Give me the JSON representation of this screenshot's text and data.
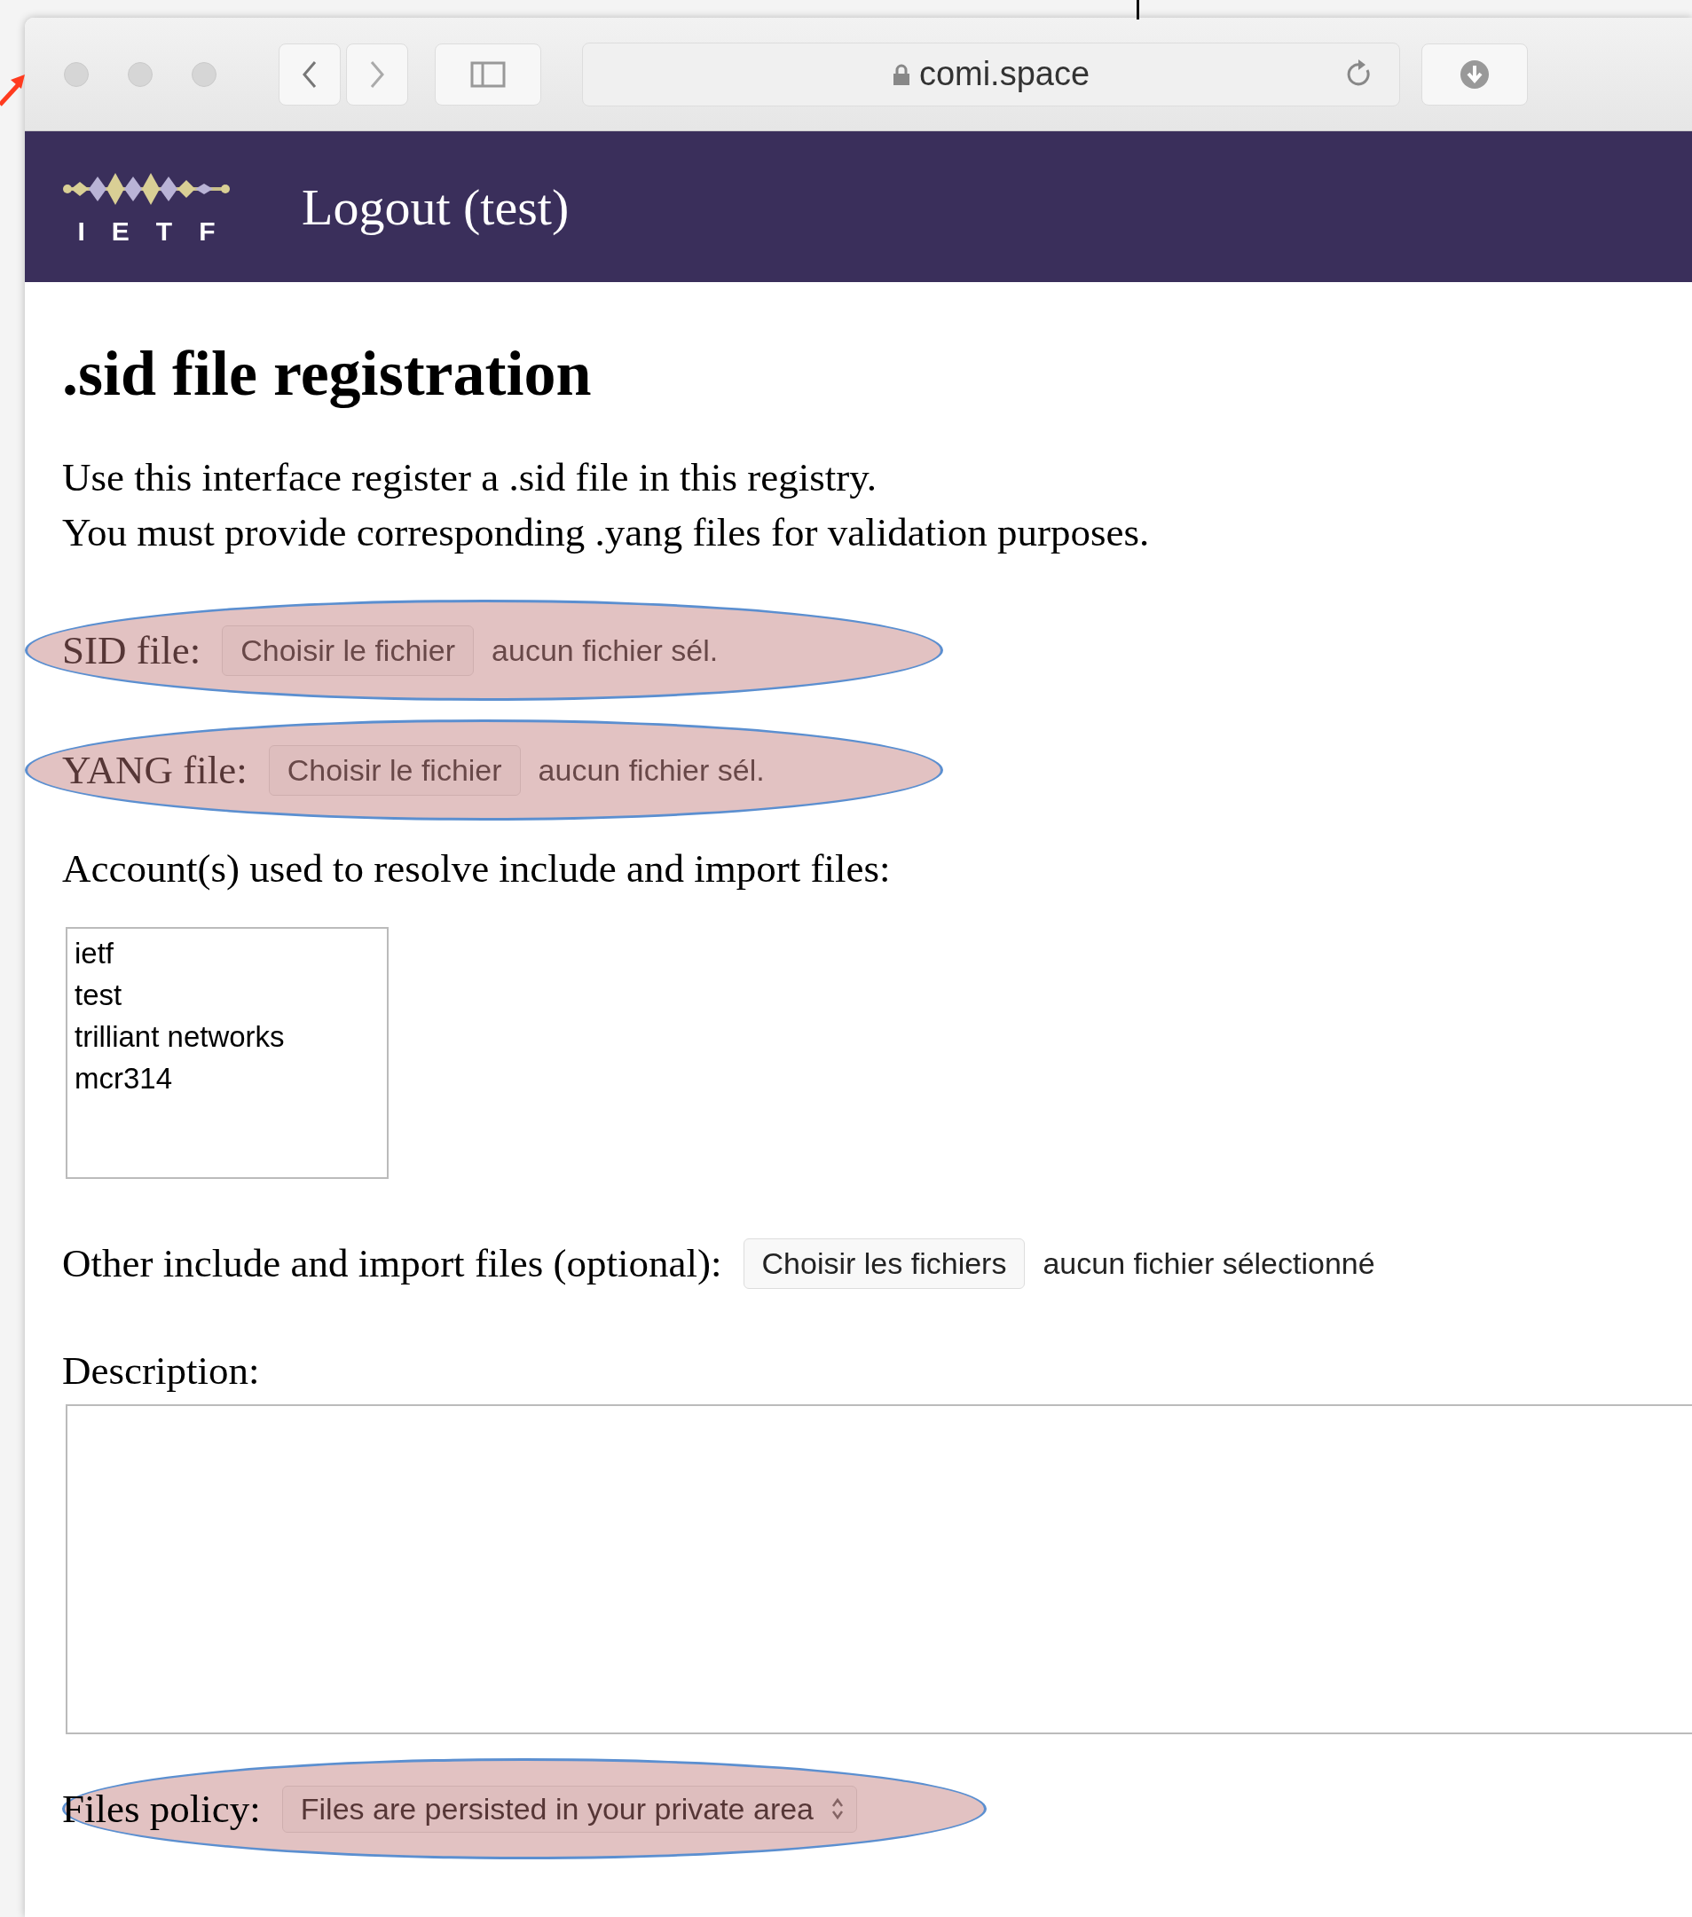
{
  "browser": {
    "url": "comi.space"
  },
  "navbar": {
    "logo_text": "IETF",
    "link": "Logout (test)"
  },
  "heading": ".sid file registration",
  "intro": [
    "Use this interface register a .sid file in this registry.",
    "You must provide corresponding .yang files for validation purposes."
  ],
  "fields": [
    {
      "kind": "file",
      "label": "SID file:",
      "button": "Choisir le fichier",
      "value": "aucun fichier sél.",
      "annotated": true
    },
    {
      "kind": "file",
      "label": "YANG file:",
      "button": "Choisir le fichier",
      "value": "aucun fichier sél.",
      "annotated": true
    },
    {
      "kind": "listbox",
      "label": "Account(s) used to resolve include and import files:",
      "options": [
        {
          "label": "ietf",
          "selected": false
        },
        {
          "label": "test",
          "selected": false
        },
        {
          "label": "trilliant networks",
          "selected": false
        },
        {
          "label": "mcr314",
          "selected": false
        }
      ],
      "annotated": false
    },
    {
      "kind": "file",
      "label": "Other include and import files (optional):",
      "button": "Choisir les fichiers",
      "value": "aucun fichier sélectionné",
      "annotated": false
    },
    {
      "kind": "textarea",
      "label": "Description:",
      "annotated": false
    },
    {
      "kind": "select",
      "label": "Files policy:",
      "value": "Files are persisted in your private area",
      "annotated": true
    }
  ]
}
